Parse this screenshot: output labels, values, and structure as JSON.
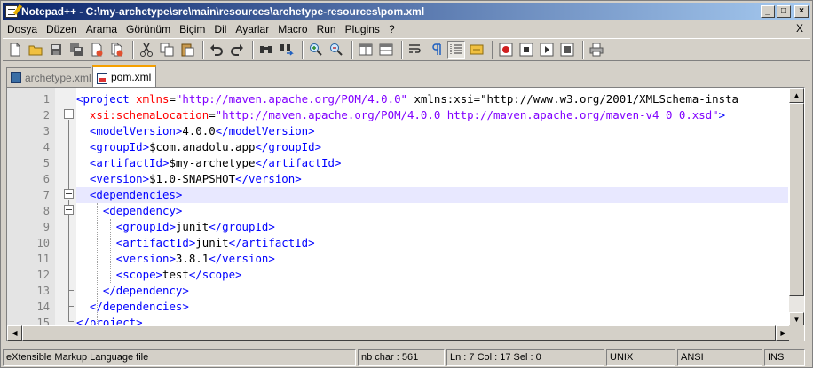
{
  "window": {
    "title": "Notepad++ - C:\\my-archetype\\src\\main\\resources\\archetype-resources\\pom.xml",
    "controls": {
      "minimize": "_",
      "maximize": "□",
      "close": "×"
    }
  },
  "menu": {
    "items": [
      "Dosya",
      "Düzen",
      "Arama",
      "Görünüm",
      "Biçim",
      "Dil",
      "Ayarlar",
      "Macro",
      "Run",
      "Plugins",
      "?"
    ],
    "close_doc": "X"
  },
  "toolbar": {
    "buttons": [
      "new-file-icon",
      "open-file-icon",
      "save-icon",
      "save-all-icon",
      "close-icon",
      "close-all-icon",
      "cut-icon",
      "copy-icon",
      "paste-icon",
      "undo-icon",
      "redo-icon",
      "find-icon",
      "replace-icon",
      "zoom-in-icon",
      "zoom-out-icon",
      "sync-vertical-icon",
      "sync-horizontal-icon",
      "word-wrap-icon",
      "show-all-chars-icon",
      "indent-guide-icon",
      "user-lang-icon",
      "record-macro-icon",
      "stop-macro-icon",
      "play-macro-icon",
      "save-macro-icon",
      "print-icon"
    ]
  },
  "tabs": [
    {
      "label": "archetype.xml",
      "active": false
    },
    {
      "label": "pom.xml",
      "active": true
    }
  ],
  "editor": {
    "current_line": 7,
    "lines": [
      {
        "n": "1",
        "text": "<project xmlns=\"http://maven.apache.org/POM/4.0.0\" xmlns:xsi=\"http://www.w3.org/2001/XMLSchema-insta"
      },
      {
        "n": "2",
        "text": "  xsi:schemaLocation=\"http://maven.apache.org/POM/4.0.0 http://maven.apache.org/maven-v4_0_0.xsd\">"
      },
      {
        "n": "3",
        "text": "  <modelVersion>4.0.0</modelVersion>"
      },
      {
        "n": "4",
        "text": "  <groupId>$com.anadolu.app</groupId>"
      },
      {
        "n": "5",
        "text": "  <artifactId>$my-archetype</artifactId>"
      },
      {
        "n": "6",
        "text": "  <version>$1.0-SNAPSHOT</version>"
      },
      {
        "n": "7",
        "text": "  <dependencies>"
      },
      {
        "n": "8",
        "text": "    <dependency>"
      },
      {
        "n": "9",
        "text": "      <groupId>junit</groupId>"
      },
      {
        "n": "10",
        "text": "      <artifactId>junit</artifactId>"
      },
      {
        "n": "11",
        "text": "      <version>3.8.1</version>"
      },
      {
        "n": "12",
        "text": "      <scope>test</scope>"
      },
      {
        "n": "13",
        "text": "    </dependency>"
      },
      {
        "n": "14",
        "text": "  </dependencies>"
      },
      {
        "n": "15",
        "text": "</project>"
      }
    ]
  },
  "status": {
    "language": "eXtensible Markup Language file",
    "nb_char": "nb char : 561",
    "position": "Ln : 7    Col : 17    Sel : 0",
    "eol": "UNIX",
    "encoding": "ANSI",
    "mode": "INS"
  },
  "colors": {
    "tag": "#0000ff",
    "attr": "#ff0000",
    "value": "#8000ff",
    "text": "#000000",
    "active_tab": "#f5a000",
    "current_line": "#e8e8ff"
  }
}
